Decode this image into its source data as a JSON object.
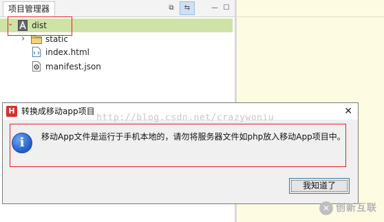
{
  "project_manager": {
    "tab_label": "项目管理器",
    "toolbar": {
      "collapse_label": "⧉",
      "link_label": "⇆",
      "minimize_label": "—",
      "maximize_label": "☐"
    }
  },
  "tree": {
    "root": {
      "expander": "⌄",
      "icon": "project-folder-icon",
      "label": "dist"
    },
    "children": [
      {
        "expander": "›",
        "icon": "folder-icon",
        "label": "static"
      },
      {
        "icon": "html-file-icon",
        "label": "index.html"
      },
      {
        "icon": "json-file-icon",
        "label": "manifest.json"
      }
    ]
  },
  "dialog": {
    "title": "转换成移动app项目",
    "close_label": "✕",
    "watermark": "http://blog.csdn.net/crazywoniu",
    "info_glyph": "i",
    "message": "移动App文件是运行于手机本地的，请勿将服务器文件如php放入移动App项目中。",
    "ok_label": "我知道了"
  },
  "brand": {
    "mark": "✕",
    "text": "创新互联"
  },
  "colors": {
    "selection": "#cfe3a6",
    "editor_bg": "#fdfce3",
    "annotation": "#e02020",
    "dialog_icon": "#d9302b"
  }
}
